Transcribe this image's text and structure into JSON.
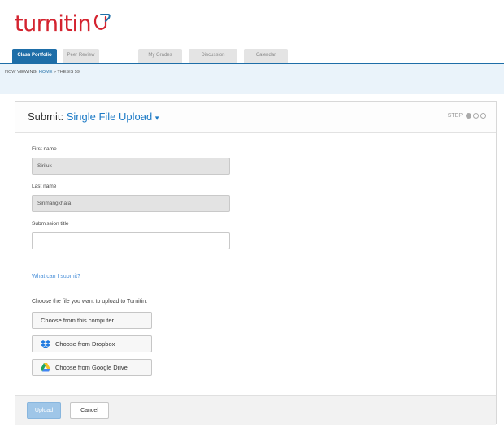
{
  "brand": {
    "logo_text": "turnitin",
    "color": "#d4232f"
  },
  "tabs": [
    {
      "label": "Class Portfolio",
      "active": true
    },
    {
      "label": "Peer Review",
      "active": false
    },
    {
      "label": "My Grades",
      "active": false
    },
    {
      "label": "Discussion",
      "active": false
    },
    {
      "label": "Calendar",
      "active": false
    }
  ],
  "breadcrumb": {
    "prefix": "NOW VIEWING:",
    "home": "HOME",
    "separator": "»",
    "current": "THESIS 59"
  },
  "submit": {
    "title_prefix": "Submit:",
    "mode": "Single File Upload",
    "caret": "▾",
    "step_label": "STEP",
    "step_current": 1,
    "step_total": 3
  },
  "form": {
    "first_name_label": "First name",
    "first_name_value": "Siriluk",
    "last_name_label": "Last name",
    "last_name_value": "Sirimangkhala",
    "title_label": "Submission title",
    "title_value": ""
  },
  "help_link": "What can I submit?",
  "choose_instruction": "Choose the file you want to upload to Turnitin:",
  "buttons": {
    "computer": "Choose from this computer",
    "dropbox": "Choose from Dropbox",
    "drive": "Choose from Google Drive",
    "upload": "Upload",
    "cancel": "Cancel"
  },
  "colors": {
    "accent": "#1e6ea8",
    "link": "#1e7bc6",
    "dropbox": "#1f7ae0",
    "upload_disabled": "#9fc6e8"
  }
}
